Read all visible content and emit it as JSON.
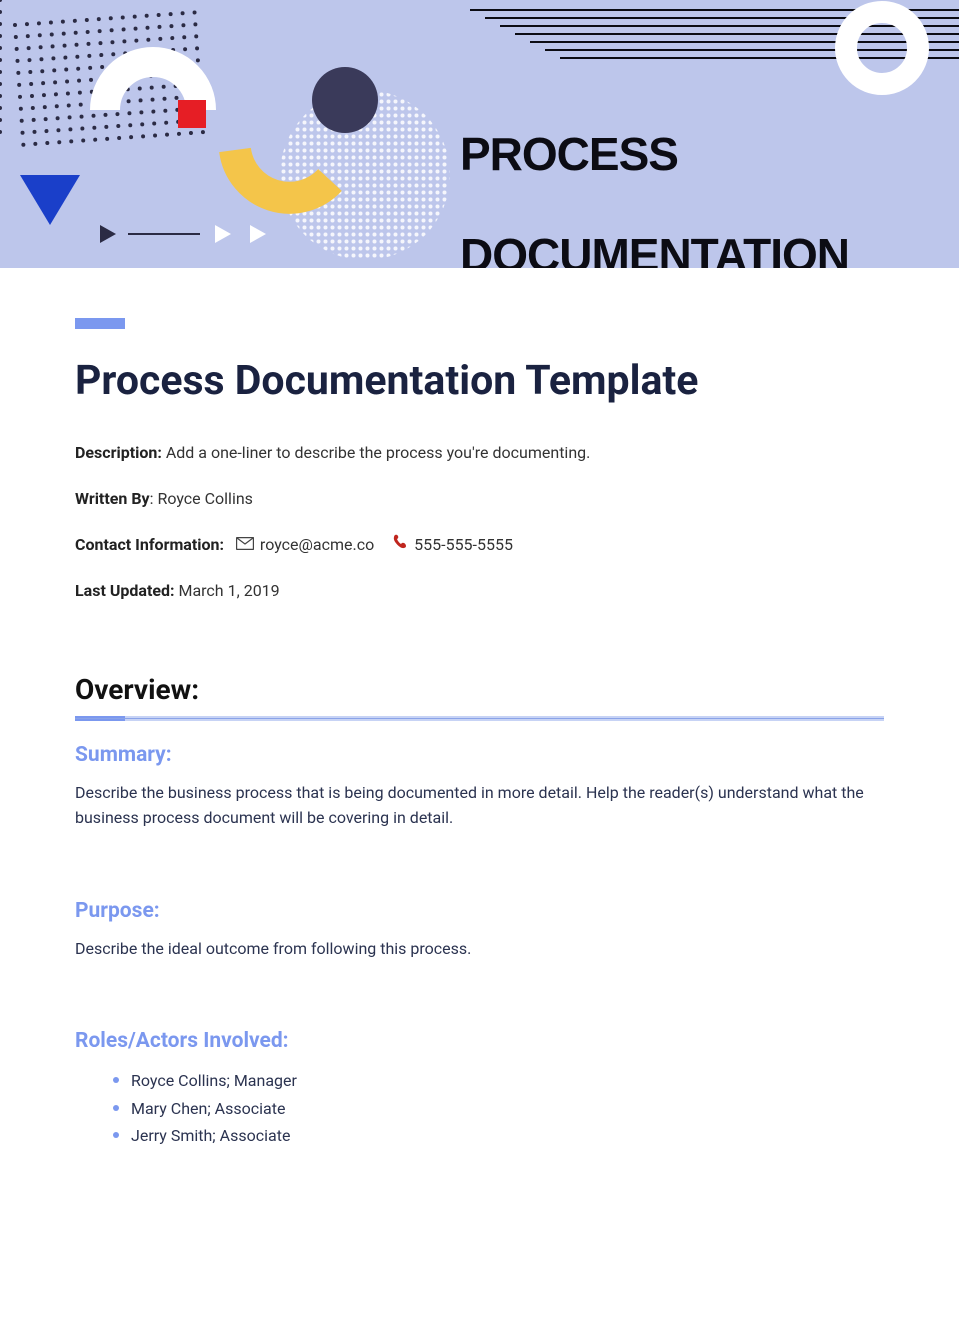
{
  "banner": {
    "line1": "PROCESS",
    "line2": "DOCUMENTATION"
  },
  "docTitle": "Process Documentation Template",
  "meta": {
    "descriptionLabel": "Description:",
    "descriptionText": " Add a one-liner to describe the process you're documenting.",
    "writtenByLabel": "Written By",
    "writtenByText": ": Royce Collins",
    "contactLabel": "Contact Information:",
    "email": "royce@acme.co",
    "phone": "555-555-5555",
    "lastUpdatedLabel": "Last Updated:",
    "lastUpdatedText": " March 1, 2019"
  },
  "sections": {
    "overviewHeading": "Overview:",
    "summary": {
      "heading": "Summary:",
      "text": "Describe the business process that is being documented in more detail. Help the reader(s) understand what the business process document will be covering in detail."
    },
    "purpose": {
      "heading": "Purpose:",
      "text": "Describe the ideal outcome from following this process."
    },
    "roles": {
      "heading": "Roles/Actors Involved:",
      "items": [
        "Royce Collins; Manager",
        "Mary Chen; Associate",
        "Jerry Smith; Associate"
      ]
    }
  }
}
